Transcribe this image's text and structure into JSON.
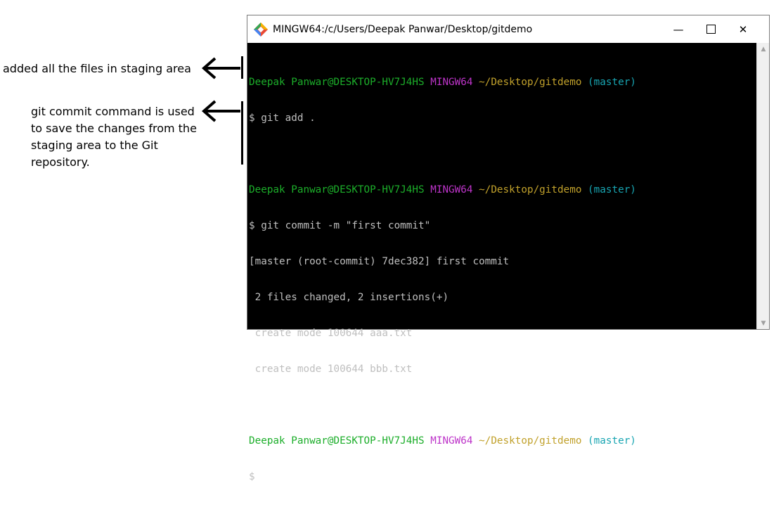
{
  "annotations": {
    "note1": "added all the files in staging area",
    "note2": "git commit command is used to save the changes from the staging area to the Git repository."
  },
  "window": {
    "title": "MINGW64:/c/Users/Deepak Panwar/Desktop/gitdemo",
    "minimize_glyph": "—",
    "close_glyph": "✕",
    "app_icon": "git-diamond-icon",
    "colors": {
      "background": "#000000",
      "user": "#1cae2a",
      "host": "#bd34c9",
      "path": "#c1a12b",
      "branch": "#18a5b2",
      "text": "#bfbfbf"
    }
  },
  "prompt": {
    "user": "Deepak Panwar@DESKTOP-HV7J4HS",
    "host": "MINGW64",
    "path": "~/Desktop/gitdemo",
    "branch": "(master)",
    "symbol": "$"
  },
  "terminal": {
    "cmd1": "$ git add .",
    "cmd2": "$ git commit -m \"first commit\"",
    "out1": "[master (root-commit) 7dec382] first commit",
    "out2": " 2 files changed, 2 insertions(+)",
    "out3": " create mode 100644 aaa.txt",
    "out4": " create mode 100644 bbb.txt",
    "cmd3": "$"
  }
}
